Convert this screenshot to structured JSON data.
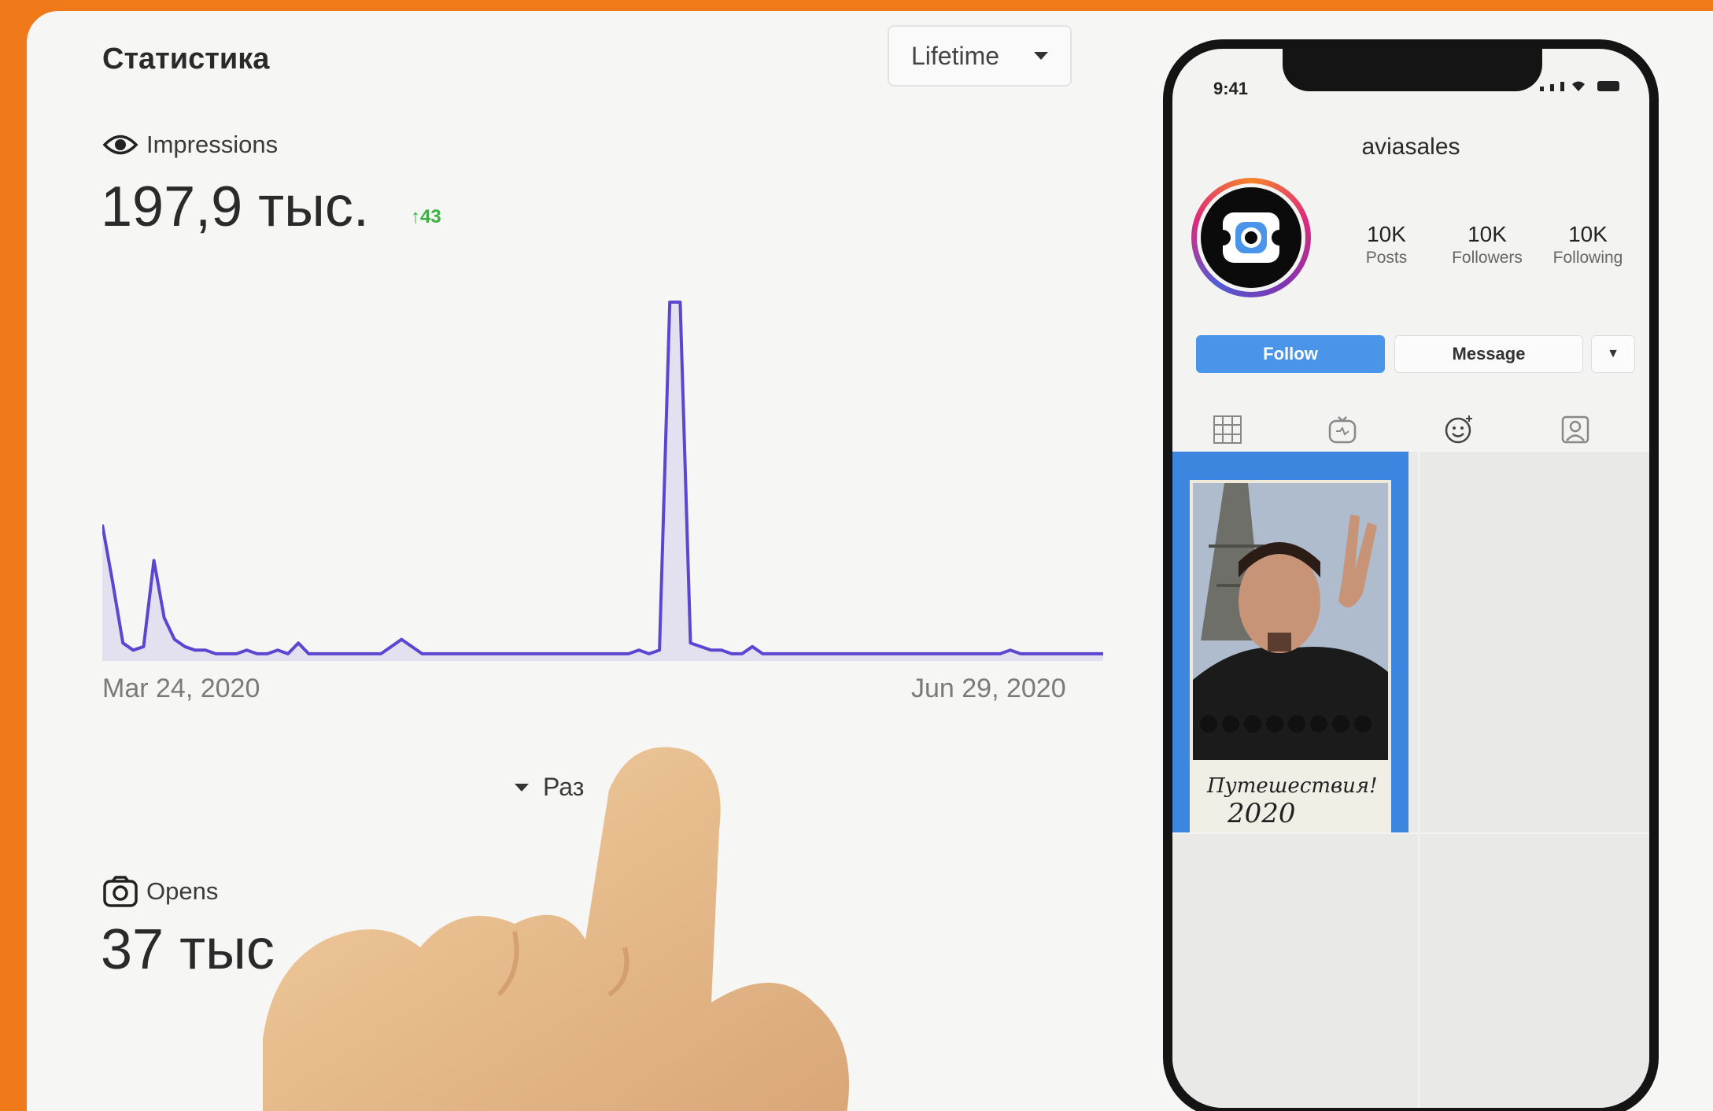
{
  "dashboard": {
    "title": "Статистика",
    "period_selector": {
      "label": "Lifetime"
    },
    "impressions": {
      "label": "Impressions",
      "value": "197,9 тыс.",
      "delta": "43",
      "chart": {
        "start_date": "Mar 24, 2020",
        "end_date": "Jun 29, 2020"
      }
    },
    "expand_label": "Раз",
    "opens": {
      "label": "Opens",
      "value": "37 тыс"
    }
  },
  "chart_data": {
    "type": "area",
    "x_start": "Mar 24, 2020",
    "x_end": "Jun 29, 2020",
    "color": "#5a46d0",
    "values": [
      38,
      22,
      5,
      3,
      4,
      28,
      12,
      6,
      4,
      3,
      3,
      2,
      2,
      2,
      3,
      2,
      2,
      3,
      2,
      5,
      2,
      2,
      2,
      2,
      2,
      2,
      2,
      2,
      4,
      6,
      4,
      2,
      2,
      2,
      2,
      2,
      2,
      2,
      2,
      2,
      2,
      2,
      2,
      2,
      2,
      2,
      2,
      2,
      2,
      2,
      2,
      2,
      3,
      2,
      3,
      100,
      100,
      5,
      4,
      3,
      3,
      2,
      2,
      4,
      2,
      2,
      2,
      2,
      2,
      2,
      2,
      2,
      2,
      2,
      2,
      2,
      2,
      2,
      2,
      2,
      2,
      2,
      2,
      2,
      2,
      2,
      2,
      2,
      3,
      2,
      2,
      2,
      2,
      2,
      2,
      2,
      2,
      2
    ]
  },
  "phone": {
    "time": "9:41",
    "username": "aviasales",
    "stats": [
      {
        "value": "10K",
        "label": "Posts"
      },
      {
        "value": "10K",
        "label": "Followers"
      },
      {
        "value": "10K",
        "label": "Following"
      }
    ],
    "follow_label": "Follow",
    "message_label": "Message",
    "post": {
      "caption": "Путешествия!",
      "year": "2020"
    },
    "colors": {
      "follow": "#4a95ea",
      "post_bg": "#3d86e0"
    }
  }
}
